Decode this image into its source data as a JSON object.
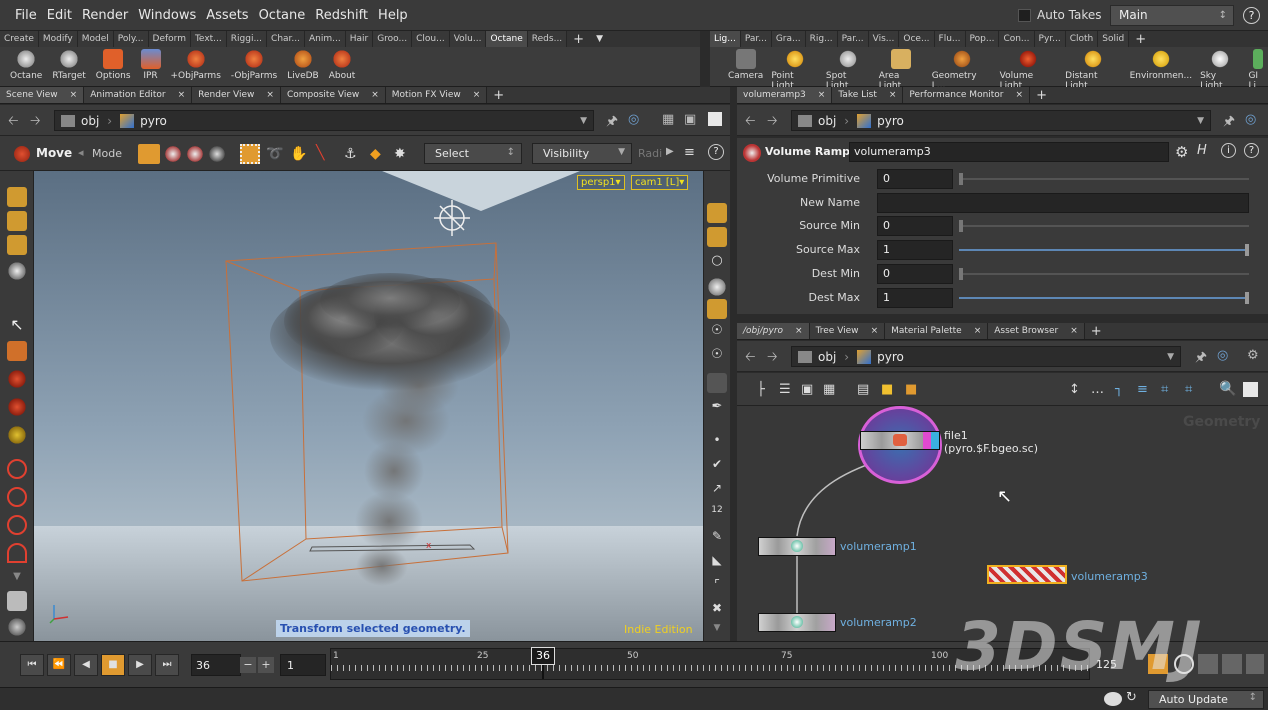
{
  "menubar": {
    "items": [
      "File",
      "Edit",
      "Render",
      "Windows",
      "Assets",
      "Octane",
      "Redshift",
      "Help"
    ],
    "auto_takes": "Auto Takes",
    "desktop": "Main"
  },
  "shelf_left": {
    "tabs": [
      "Create",
      "Modify",
      "Model",
      "Poly...",
      "Deform",
      "Text...",
      "Riggi...",
      "Char...",
      "Anim...",
      "Hair",
      "Groo...",
      "Clou...",
      "Volu...",
      "Octane",
      "Reds..."
    ],
    "active_tab": "Octane",
    "tools": [
      "Octane",
      "RTarget",
      "Options",
      "IPR",
      "+ObjParms",
      "-ObjParms",
      "LiveDB",
      "About"
    ]
  },
  "shelf_right": {
    "tabs": [
      "Lig...",
      "Par...",
      "Gra...",
      "Rig...",
      "Par...",
      "Vis...",
      "Oce...",
      "Flu...",
      "Pop...",
      "Con...",
      "Pyr...",
      "Cloth",
      "Solid"
    ],
    "tools": [
      "Camera",
      "Point Light",
      "Spot Light",
      "Area Light",
      "Geometry L...",
      "Volume Light",
      "Distant Light",
      "Environmen...",
      "Sky Light",
      "GI Li"
    ]
  },
  "left_pane": {
    "tabs": [
      "Scene View",
      "Animation Editor",
      "Render View",
      "Composite View",
      "Motion FX View"
    ],
    "path": [
      "obj",
      "pyro"
    ],
    "toolbar": {
      "move_label": "Move",
      "mode_label": "Mode",
      "select_label": "Select",
      "visibility_label": "Visibility",
      "radi_label": "Radi"
    },
    "viewport": {
      "persp": "persp1▾",
      "cam": "cam1 [L]▾",
      "status": "Transform selected geometry.",
      "edition": "Indie Edition"
    }
  },
  "params_pane": {
    "tabs": [
      "volumeramp3",
      "Take List",
      "Performance Monitor"
    ],
    "path": [
      "obj",
      "pyro"
    ],
    "node_type": "Volume Ramp",
    "node_name": "volumeramp3",
    "params": [
      {
        "label": "Volume Primitive",
        "value": "0",
        "fill": 0
      },
      {
        "label": "New Name",
        "value": "",
        "fill": null
      },
      {
        "label": "Source Min",
        "value": "0",
        "fill": 0
      },
      {
        "label": "Source Max",
        "value": "1",
        "fill": 1
      },
      {
        "label": "Dest Min",
        "value": "0",
        "fill": 0
      },
      {
        "label": "Dest Max",
        "value": "1",
        "fill": 1
      }
    ]
  },
  "network_pane": {
    "tabs": [
      "/obj/pyro",
      "Tree View",
      "Material Palette",
      "Asset Browser"
    ],
    "path": [
      "obj",
      "pyro"
    ],
    "context_label": "Geometry",
    "nodes": {
      "file1": {
        "name": "file1",
        "sub": "(pyro.$F.bgeo.sc)"
      },
      "volumeramp1": {
        "name": "volumeramp1"
      },
      "volumeramp2": {
        "name": "volumeramp2"
      },
      "volumeramp3": {
        "name": "volumeramp3"
      }
    }
  },
  "timeline": {
    "frame": "36",
    "start": "1",
    "end": "125",
    "current_marker": "36",
    "ticks": [
      "1",
      "25",
      "50",
      "75",
      "100"
    ]
  },
  "statusbar": {
    "auto_update": "Auto Update"
  },
  "watermark": "3DSMJ",
  "colors": {
    "accent": "#f0a020",
    "link": "#6fb0e0",
    "bound": "#c8703a"
  }
}
